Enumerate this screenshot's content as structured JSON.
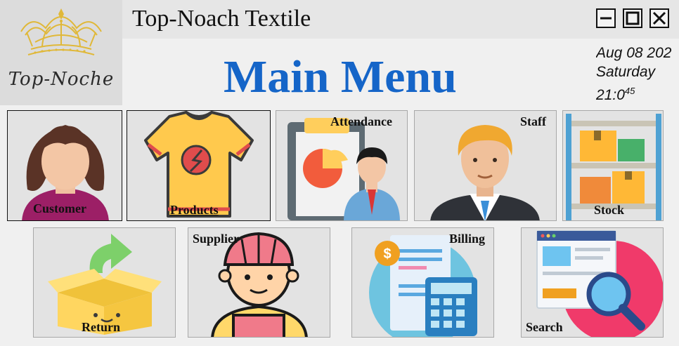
{
  "window": {
    "title": "Top-Noach Textile",
    "controls": {
      "minimize": "—",
      "maximize": "☐",
      "close": "✕"
    }
  },
  "logo": {
    "text": "Top-Noche",
    "icon": "crown-icon"
  },
  "header": {
    "title": "Main Menu"
  },
  "clock": {
    "date": "Aug 08 202",
    "day": "Saturday",
    "time": "21:0",
    "seconds": "45"
  },
  "menu": {
    "row1": [
      {
        "label": "Customer",
        "icon": "customer-icon"
      },
      {
        "label": "Products",
        "icon": "tshirt-icon"
      },
      {
        "label": "Attendance",
        "icon": "attendance-chart-icon"
      },
      {
        "label": "Staff",
        "icon": "staff-icon"
      },
      {
        "label": "Stock",
        "icon": "stock-shelf-icon"
      }
    ],
    "row2": [
      {
        "label": "Return",
        "icon": "return-box-icon"
      },
      {
        "label": "Supplier",
        "icon": "supplier-icon"
      },
      {
        "label": "Billing",
        "icon": "billing-calculator-icon"
      },
      {
        "label": "Search",
        "icon": "search-document-icon"
      }
    ]
  },
  "colors": {
    "title_blue": "#1565c8",
    "tile_bg": "#e3e3e3",
    "window_bg": "#f0f0f0"
  }
}
